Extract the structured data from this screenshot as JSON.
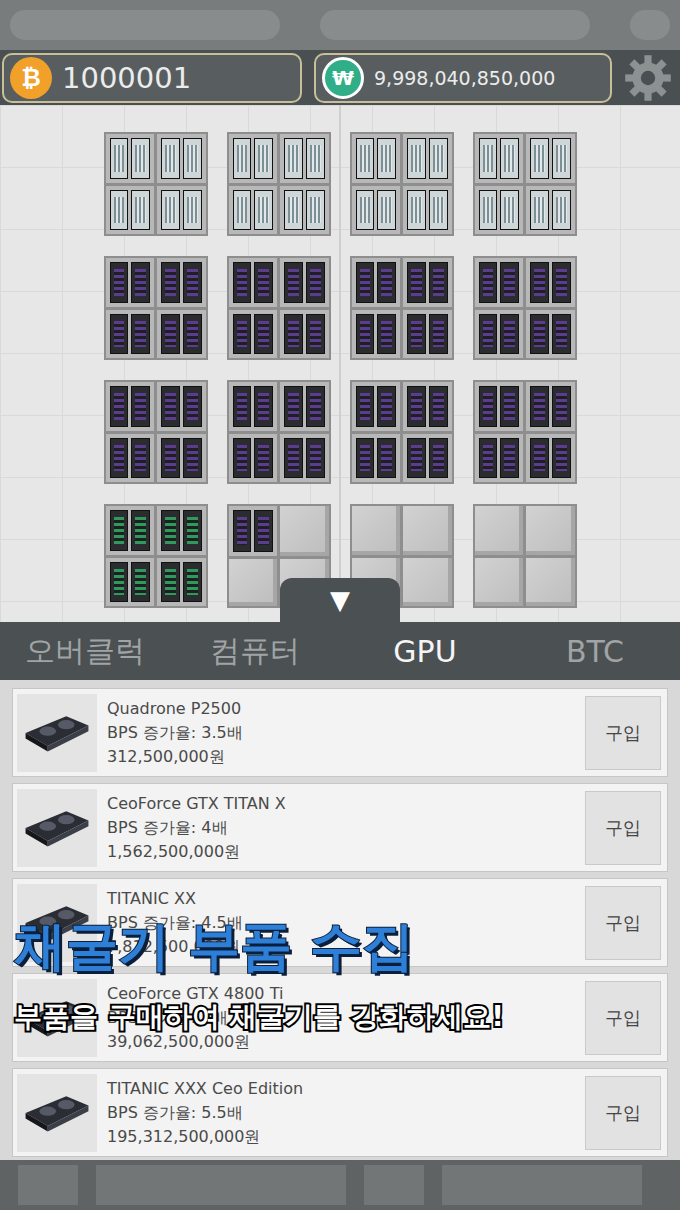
{
  "top_bar": {
    "coin": {
      "icon": "₿",
      "amount": "1000001"
    },
    "cash": {
      "icon": "₩",
      "amount": "9,998,040,850,000"
    }
  },
  "farm": {
    "tiles": [
      {
        "filled": 4,
        "kind": "rack"
      },
      {
        "filled": 4,
        "kind": "rack"
      },
      {
        "filled": 4,
        "kind": "rack"
      },
      {
        "filled": 4,
        "kind": "rack"
      },
      {
        "filled": 4,
        "kind": "rig"
      },
      {
        "filled": 4,
        "kind": "rig"
      },
      {
        "filled": 4,
        "kind": "rig"
      },
      {
        "filled": 4,
        "kind": "rig"
      },
      {
        "filled": 4,
        "kind": "rig"
      },
      {
        "filled": 4,
        "kind": "rig"
      },
      {
        "filled": 4,
        "kind": "rig"
      },
      {
        "filled": 4,
        "kind": "rig"
      },
      {
        "filled": 4,
        "kind": "green"
      },
      {
        "filled": 1,
        "kind": "rig"
      },
      {
        "filled": 0,
        "kind": "rig"
      },
      {
        "filled": 0,
        "kind": "rig"
      }
    ]
  },
  "toggle": {
    "icon": "▼"
  },
  "tabs": [
    {
      "label": "오버클럭",
      "selected": false
    },
    {
      "label": "컴퓨터",
      "selected": false
    },
    {
      "label": "GPU",
      "selected": true
    },
    {
      "label": "BTC",
      "selected": false
    }
  ],
  "shop_items": [
    {
      "name": "Quadrone P2500",
      "bps": "BPS 증가율: 3.5배",
      "price": "312,500,000원",
      "button": "구입"
    },
    {
      "name": "CeoForce GTX TITAN X",
      "bps": "BPS 증가율: 4배",
      "price": "1,562,500,000원",
      "button": "구입"
    },
    {
      "name": "TITANIC XX",
      "bps": "BPS 증가율: 4.5배",
      "price": "7,812,500,000원",
      "button": "구입"
    },
    {
      "name": "CeoForce GTX 4800 Ti",
      "bps": "BPS 증가율: 5배",
      "price": "39,062,500,000원",
      "button": "구입"
    },
    {
      "name": "TITANIC XXX Ceo Edition",
      "bps": "BPS 증가율: 5.5배",
      "price": "195,312,500,000원",
      "button": "구입"
    }
  ],
  "banner": {
    "title": "채굴기 부품 수집",
    "subtitle": "부품을 구매하여 채굴기를 강화하세요!"
  }
}
